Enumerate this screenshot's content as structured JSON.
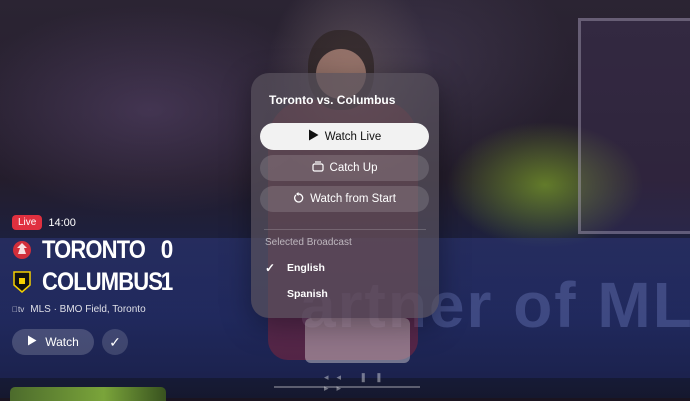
{
  "game": {
    "status_badge": "Live",
    "time": "14:00",
    "home_team": {
      "name": "TORONTO",
      "score": "0"
    },
    "away_team": {
      "name": "COLUMBUS",
      "score": "1"
    },
    "meta": "MLS · BMO Field, Toronto",
    "watch_label": "Watch"
  },
  "popup": {
    "title": "Toronto vs. Columbus",
    "watch_live": "Watch Live",
    "catch_up": "Catch Up",
    "watch_from_start": "Watch from Start",
    "section_label": "Selected Broadcast",
    "options": [
      {
        "label": "English",
        "selected": true
      },
      {
        "label": "Spanish",
        "selected": false
      }
    ]
  },
  "background": {
    "board_text": "artner of MLS",
    "brand_mark": "tv"
  },
  "colors": {
    "live": "#e0303f",
    "primary_button": "#f2f2f2"
  }
}
